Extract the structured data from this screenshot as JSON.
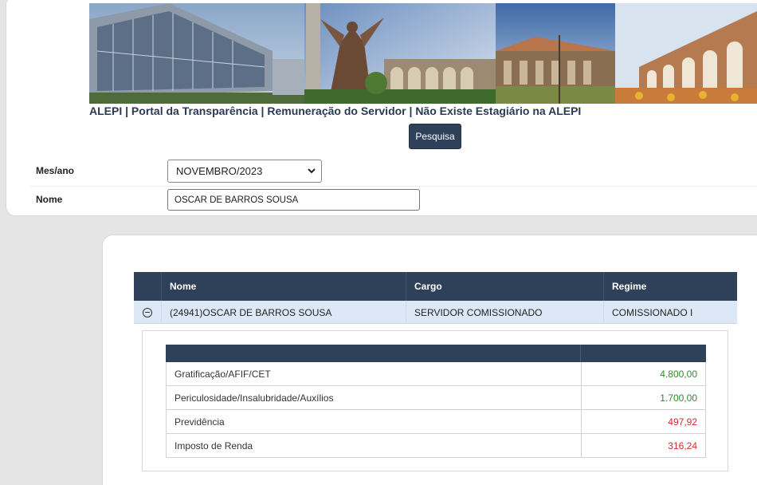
{
  "header": {
    "title": "ALEPI | Portal da Transparência | Remuneração do Servidor | Não Existe Estagiário na ALEPI",
    "search_button": "Pesquisa"
  },
  "form": {
    "month_label": "Mes/ano",
    "month_value": "NOVEMBRO/2023",
    "name_label": "Nome",
    "name_value": "OSCAR DE BARROS SOUSA"
  },
  "table": {
    "columns": [
      "Nome",
      "Cargo",
      "Regime"
    ],
    "row": {
      "nome": "(24941)OSCAR DE BARROS SOUSA",
      "cargo": "SERVIDOR COMISSIONADO",
      "regime": "COMISSIONADO I"
    }
  },
  "details": [
    {
      "label": "Gratificação/AFIF/CET",
      "value": "4.800,00",
      "color": "#2e8b2e"
    },
    {
      "label": "Periculosidade/Insalubridade/Auxílios",
      "value": "1.700,00",
      "color": "#2e8b2e"
    },
    {
      "label": "Previdência",
      "value": "497,92",
      "color": "#d42a2a"
    },
    {
      "label": "Imposto de Renda",
      "value": "316,24",
      "color": "#d42a2a"
    }
  ],
  "icons": {
    "toggle": "collapse-circle-minus-icon",
    "select": "chevron-down-icon"
  }
}
